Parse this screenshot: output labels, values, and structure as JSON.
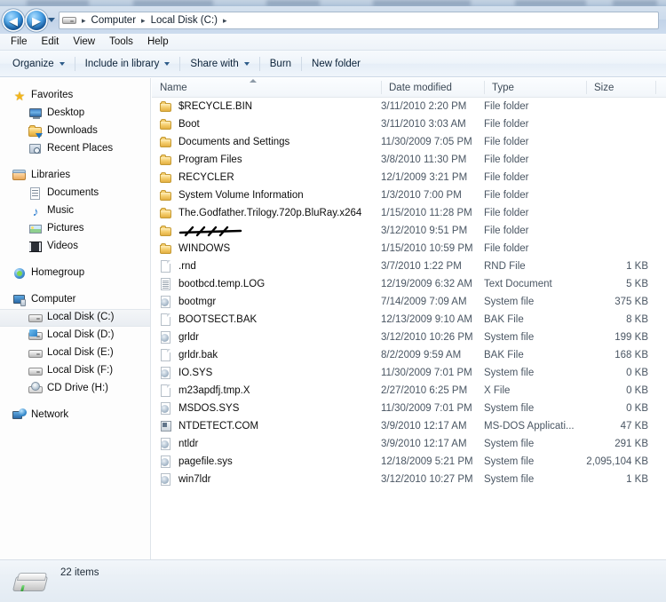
{
  "window": {
    "title": "Local Disk (C:)"
  },
  "address_bar": {
    "back_label": "◀",
    "forward_label": "▶",
    "drive_icon": "drive-icon",
    "crumbs": [
      "Computer",
      "Local Disk (C:)"
    ],
    "separator": "▸",
    "trailing_separator": "▸"
  },
  "menu_bar": {
    "items": [
      "File",
      "Edit",
      "View",
      "Tools",
      "Help"
    ]
  },
  "command_bar": {
    "items": [
      {
        "label": "Organize",
        "has_caret": true
      },
      {
        "label": "Include in library",
        "has_caret": true
      },
      {
        "label": "Share with",
        "has_caret": true
      },
      {
        "label": "Burn",
        "has_caret": false
      },
      {
        "label": "New folder",
        "has_caret": false
      }
    ]
  },
  "sidebar": {
    "groups": [
      {
        "header": {
          "label": "Favorites",
          "icon": "star-icon"
        },
        "items": [
          {
            "label": "Desktop",
            "icon": "desktop-icon"
          },
          {
            "label": "Downloads",
            "icon": "downloads-folder-icon"
          },
          {
            "label": "Recent Places",
            "icon": "recent-places-icon"
          }
        ]
      },
      {
        "header": {
          "label": "Libraries",
          "icon": "libraries-icon"
        },
        "items": [
          {
            "label": "Documents",
            "icon": "document-icon"
          },
          {
            "label": "Music",
            "icon": "music-note-icon"
          },
          {
            "label": "Pictures",
            "icon": "picture-icon"
          },
          {
            "label": "Videos",
            "icon": "video-film-icon"
          }
        ]
      },
      {
        "header": {
          "label": "Homegroup",
          "icon": "homegroup-icon"
        },
        "items": []
      },
      {
        "header": {
          "label": "Computer",
          "icon": "computer-icon"
        },
        "items": [
          {
            "label": "Local Disk (C:)",
            "icon": "hard-drive-icon",
            "selected": true
          },
          {
            "label": "Local Disk (D:)",
            "icon": "hard-drive-windows-icon"
          },
          {
            "label": "Local Disk (E:)",
            "icon": "hard-drive-icon"
          },
          {
            "label": "Local Disk (F:)",
            "icon": "hard-drive-icon"
          },
          {
            "label": "CD Drive (H:)",
            "icon": "cd-drive-icon"
          }
        ]
      },
      {
        "header": {
          "label": "Network",
          "icon": "network-icon"
        },
        "items": []
      }
    ]
  },
  "file_list": {
    "columns": [
      {
        "key": "name",
        "label": "Name",
        "sorted": true,
        "sort_direction": "ascending"
      },
      {
        "key": "date",
        "label": "Date modified"
      },
      {
        "key": "type",
        "label": "Type"
      },
      {
        "key": "size",
        "label": "Size"
      }
    ],
    "rows": [
      {
        "name": "$RECYCLE.BIN",
        "date": "3/11/2010 2:20 PM",
        "type": "File folder",
        "size": "",
        "icon": "folder-icon"
      },
      {
        "name": "Boot",
        "date": "3/11/2010 3:03 AM",
        "type": "File folder",
        "size": "",
        "icon": "folder-icon"
      },
      {
        "name": "Documents and Settings",
        "date": "11/30/2009 7:05 PM",
        "type": "File folder",
        "size": "",
        "icon": "folder-icon"
      },
      {
        "name": "Program Files",
        "date": "3/8/2010 11:30 PM",
        "type": "File folder",
        "size": "",
        "icon": "folder-icon"
      },
      {
        "name": "RECYCLER",
        "date": "12/1/2009 3:21 PM",
        "type": "File folder",
        "size": "",
        "icon": "folder-icon"
      },
      {
        "name": "System Volume Information",
        "date": "1/3/2010 7:00 PM",
        "type": "File folder",
        "size": "",
        "icon": "folder-icon"
      },
      {
        "name": "The.Godfather.Trilogy.720p.BluRay.x264",
        "date": "1/15/2010 11:28 PM",
        "type": "File folder",
        "size": "",
        "icon": "folder-icon"
      },
      {
        "name": "",
        "redacted": true,
        "date": "3/12/2010 9:51 PM",
        "type": "File folder",
        "size": "",
        "icon": "folder-icon"
      },
      {
        "name": "WINDOWS",
        "date": "1/15/2010 10:59 PM",
        "type": "File folder",
        "size": "",
        "icon": "folder-icon"
      },
      {
        "name": ".rnd",
        "date": "3/7/2010 1:22 PM",
        "type": "RND File",
        "size": "1 KB",
        "icon": "generic-file-icon"
      },
      {
        "name": "bootbcd.temp.LOG",
        "date": "12/19/2009 6:32 AM",
        "type": "Text Document",
        "size": "5 KB",
        "icon": "text-document-icon"
      },
      {
        "name": "bootmgr",
        "date": "7/14/2009 7:09 AM",
        "type": "System file",
        "size": "375 KB",
        "icon": "system-file-icon"
      },
      {
        "name": "BOOTSECT.BAK",
        "date": "12/13/2009 9:10 AM",
        "type": "BAK File",
        "size": "8 KB",
        "icon": "generic-file-icon"
      },
      {
        "name": "grldr",
        "date": "3/12/2010 10:26 PM",
        "type": "System file",
        "size": "199 KB",
        "icon": "system-file-icon"
      },
      {
        "name": "grldr.bak",
        "date": "8/2/2009 9:59 AM",
        "type": "BAK File",
        "size": "168 KB",
        "icon": "generic-file-icon"
      },
      {
        "name": "IO.SYS",
        "date": "11/30/2009 7:01 PM",
        "type": "System file",
        "size": "0 KB",
        "icon": "system-file-icon"
      },
      {
        "name": "m23apdfj.tmp.X",
        "date": "2/27/2010 6:25 PM",
        "type": "X File",
        "size": "0 KB",
        "icon": "generic-file-icon"
      },
      {
        "name": "MSDOS.SYS",
        "date": "11/30/2009 7:01 PM",
        "type": "System file",
        "size": "0 KB",
        "icon": "system-file-icon"
      },
      {
        "name": "NTDETECT.COM",
        "date": "3/9/2010 12:17 AM",
        "type": "MS-DOS Applicati...",
        "size": "47 KB",
        "icon": "ms-dos-application-icon"
      },
      {
        "name": "ntldr",
        "date": "3/9/2010 12:17 AM",
        "type": "System file",
        "size": "291 KB",
        "icon": "system-file-icon"
      },
      {
        "name": "pagefile.sys",
        "date": "12/18/2009 5:21 PM",
        "type": "System file",
        "size": "2,095,104 KB",
        "icon": "system-file-icon"
      },
      {
        "name": "win7ldr",
        "date": "3/12/2010 10:27 PM",
        "type": "System file",
        "size": "1 KB",
        "icon": "system-file-icon"
      }
    ]
  },
  "status_bar": {
    "item_count_label": "22 items",
    "icon": "hard-drive-icon"
  },
  "colors": {
    "accent": "#1566b8",
    "folder": "#f4cd6b",
    "selection": "#eaf4fd",
    "chrome": "#ccdbec"
  }
}
